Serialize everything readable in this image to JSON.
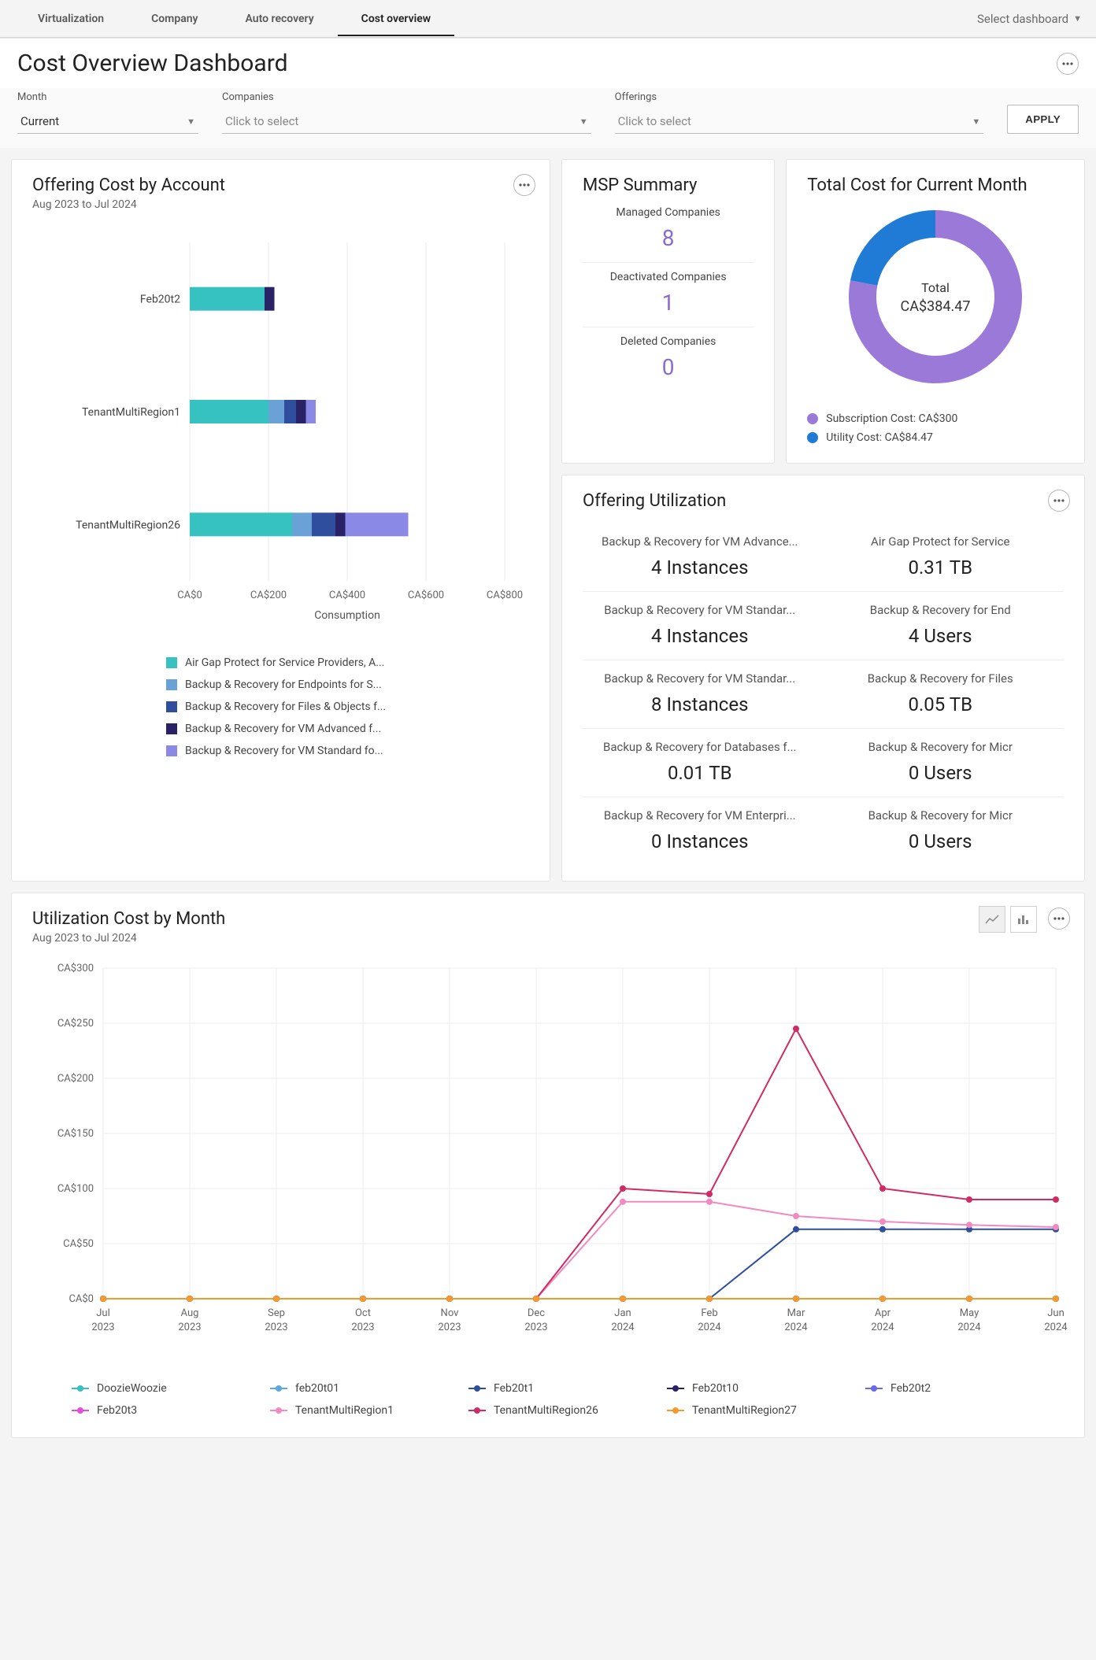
{
  "tabs": [
    "Virtualization",
    "Company",
    "Auto recovery",
    "Cost overview"
  ],
  "active_tab": "Cost overview",
  "dash_selector": "Select dashboard",
  "page_title": "Cost Overview Dashboard",
  "filters": {
    "month_label": "Month",
    "month_value": "Current",
    "companies_label": "Companies",
    "companies_placeholder": "Click to select",
    "offerings_label": "Offerings",
    "offerings_placeholder": "Click to select",
    "apply": "APPLY"
  },
  "offering_cost": {
    "title": "Offering Cost by Account",
    "subtitle": "Aug 2023 to Jul 2024",
    "xlabel": "Consumption",
    "xticks": [
      "CA$0",
      "CA$200",
      "CA$400",
      "CA$600",
      "CA$800"
    ],
    "legend": [
      {
        "color": "#37c2c2",
        "label": "Air Gap Protect for Service Providers, A..."
      },
      {
        "color": "#6aa2d8",
        "label": "Backup & Recovery for Endpoints for S..."
      },
      {
        "color": "#2f4f9e",
        "label": "Backup & Recovery for Files & Objects f..."
      },
      {
        "color": "#2a2266",
        "label": "Backup & Recovery for VM Advanced f..."
      },
      {
        "color": "#8a8ae6",
        "label": "Backup & Recovery for VM Standard fo..."
      }
    ]
  },
  "msp": {
    "title": "MSP Summary",
    "managed_label": "Managed Companies",
    "managed": "8",
    "deact_label": "Deactivated Companies",
    "deact": "1",
    "deleted_label": "Deleted Companies",
    "deleted": "0"
  },
  "total_cost": {
    "title": "Total Cost for Current Month",
    "center_label": "Total",
    "center_value": "CA$384.47",
    "legend": [
      {
        "color": "#9a79d9",
        "label": "Subscription Cost: CA$300"
      },
      {
        "color": "#1f7bd6",
        "label": "Utility Cost: CA$84.47"
      }
    ]
  },
  "off_util": {
    "title": "Offering Utilization",
    "items": [
      {
        "name": "Backup & Recovery for VM Advance...",
        "value": "4 Instances"
      },
      {
        "name": "Air Gap Protect for Service",
        "value": "0.31 TB"
      },
      {
        "name": "Backup & Recovery for VM Standar...",
        "value": "4 Instances"
      },
      {
        "name": "Backup & Recovery for End",
        "value": "4 Users"
      },
      {
        "name": "Backup & Recovery for VM Standar...",
        "value": "8 Instances"
      },
      {
        "name": "Backup & Recovery for Files",
        "value": "0.05 TB"
      },
      {
        "name": "Backup & Recovery for Databases f...",
        "value": "0.01 TB"
      },
      {
        "name": "Backup & Recovery for Micr",
        "value": "0 Users"
      },
      {
        "name": "Backup & Recovery for VM Enterpri...",
        "value": "0 Instances"
      },
      {
        "name": "Backup & Recovery for Micr",
        "value": "0 Users"
      }
    ]
  },
  "ucm": {
    "title": "Utilization Cost by Month",
    "subtitle": "Aug 2023 to Jul 2024",
    "legend": [
      {
        "color": "#37c2c2",
        "label": "DoozieWoozie"
      },
      {
        "color": "#5aa8e6",
        "label": "feb20t01"
      },
      {
        "color": "#2f4f9e",
        "label": "Feb20t1"
      },
      {
        "color": "#2a2266",
        "label": "Feb20t10"
      },
      {
        "color": "#6a6af0",
        "label": "Feb20t2"
      },
      {
        "color": "#e24fd6",
        "label": "Feb20t3"
      },
      {
        "color": "#f28ac0",
        "label": "TenantMultiRegion1"
      },
      {
        "color": "#d12b63",
        "label": "TenantMultiRegion26"
      },
      {
        "color": "#f39a2e",
        "label": "TenantMultiRegion27"
      }
    ]
  },
  "chart_data": [
    {
      "id": "offering_cost_by_account",
      "type": "bar",
      "orientation": "horizontal",
      "stacked": true,
      "xlabel": "Consumption",
      "xlim": [
        0,
        800
      ],
      "xticks": [
        0,
        200,
        400,
        600,
        800
      ],
      "currency_prefix": "CA$",
      "categories": [
        "Feb20t2",
        "TenantMultiRegion1",
        "TenantMultiRegion26"
      ],
      "series": [
        {
          "name": "Air Gap Protect for Service Providers",
          "color": "#37c2c2",
          "values": [
            190,
            200,
            260
          ]
        },
        {
          "name": "Backup & Recovery for Endpoints",
          "color": "#6aa2d8",
          "values": [
            0,
            40,
            50
          ]
        },
        {
          "name": "Backup & Recovery for Files & Objects",
          "color": "#2f4f9e",
          "values": [
            0,
            30,
            60
          ]
        },
        {
          "name": "Backup & Recovery for VM Advanced",
          "color": "#2a2266",
          "values": [
            25,
            25,
            25
          ]
        },
        {
          "name": "Backup & Recovery for VM Standard",
          "color": "#8a8ae6",
          "values": [
            0,
            25,
            160
          ]
        }
      ]
    },
    {
      "id": "total_cost_current_month",
      "type": "pie",
      "donut": true,
      "total_label": "Total",
      "total_value": 384.47,
      "currency_prefix": "CA$",
      "series": [
        {
          "name": "Subscription Cost",
          "color": "#9a79d9",
          "value": 300
        },
        {
          "name": "Utility Cost",
          "color": "#1f7bd6",
          "value": 84.47
        }
      ]
    },
    {
      "id": "utilization_cost_by_month",
      "type": "line",
      "ylabel": "",
      "ylim": [
        0,
        300
      ],
      "yticks": [
        0,
        50,
        100,
        150,
        200,
        250,
        300
      ],
      "currency_prefix": "CA$",
      "x": [
        "Jul 2023",
        "Aug 2023",
        "Sep 2023",
        "Oct 2023",
        "Nov 2023",
        "Dec 2023",
        "Jan 2024",
        "Feb 2024",
        "Mar 2024",
        "Apr 2024",
        "May 2024",
        "Jun 2024"
      ],
      "series": [
        {
          "name": "DoozieWoozie",
          "color": "#37c2c2",
          "values": [
            0,
            0,
            0,
            0,
            0,
            0,
            0,
            0,
            0,
            0,
            0,
            0
          ]
        },
        {
          "name": "feb20t01",
          "color": "#5aa8e6",
          "values": [
            0,
            0,
            0,
            0,
            0,
            0,
            0,
            0,
            0,
            0,
            0,
            0
          ]
        },
        {
          "name": "Feb20t1",
          "color": "#2f4f9e",
          "values": [
            0,
            0,
            0,
            0,
            0,
            0,
            0,
            0,
            63,
            63,
            63,
            63
          ]
        },
        {
          "name": "Feb20t10",
          "color": "#2a2266",
          "values": [
            0,
            0,
            0,
            0,
            0,
            0,
            0,
            0,
            0,
            0,
            0,
            0
          ]
        },
        {
          "name": "Feb20t2",
          "color": "#6a6af0",
          "values": [
            0,
            0,
            0,
            0,
            0,
            0,
            0,
            0,
            0,
            0,
            0,
            0
          ]
        },
        {
          "name": "Feb20t3",
          "color": "#e24fd6",
          "values": [
            0,
            0,
            0,
            0,
            0,
            0,
            0,
            0,
            0,
            0,
            0,
            0
          ]
        },
        {
          "name": "TenantMultiRegion1",
          "color": "#f28ac0",
          "values": [
            0,
            0,
            0,
            0,
            0,
            0,
            88,
            88,
            75,
            70,
            67,
            65
          ]
        },
        {
          "name": "TenantMultiRegion26",
          "color": "#d12b63",
          "values": [
            0,
            0,
            0,
            0,
            0,
            0,
            100,
            95,
            245,
            100,
            90,
            90
          ]
        },
        {
          "name": "TenantMultiRegion27",
          "color": "#f39a2e",
          "values": [
            0,
            0,
            0,
            0,
            0,
            0,
            0,
            0,
            0,
            0,
            0,
            0
          ]
        }
      ]
    }
  ]
}
